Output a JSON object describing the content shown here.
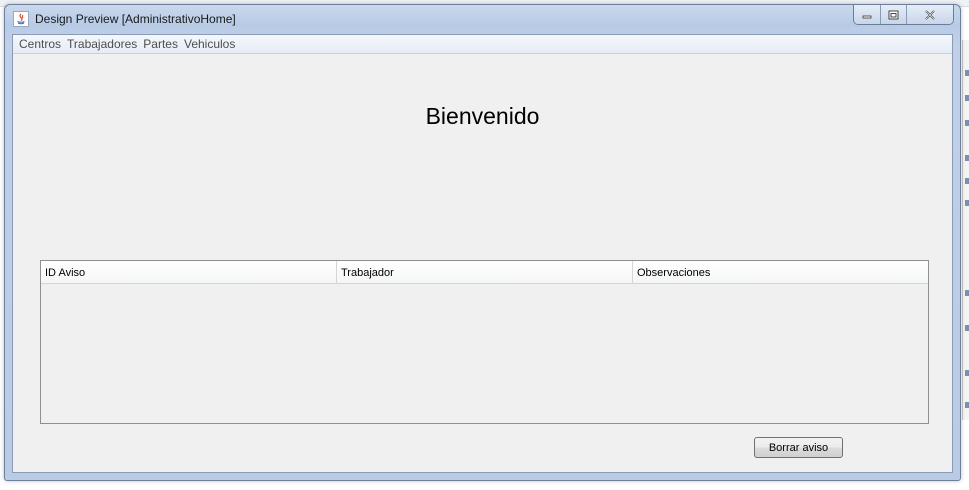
{
  "window": {
    "title": "Design Preview [AdministrativoHome]",
    "icon": "java-icon"
  },
  "menubar": {
    "items": [
      "Centros",
      "Trabajadores",
      "Partes",
      "Vehiculos"
    ]
  },
  "main": {
    "welcome": "Bienvenido",
    "table": {
      "columns": [
        "ID Aviso",
        "Trabajador",
        "Observaciones"
      ],
      "rows": []
    },
    "delete_button_label": "Borrar aviso"
  }
}
